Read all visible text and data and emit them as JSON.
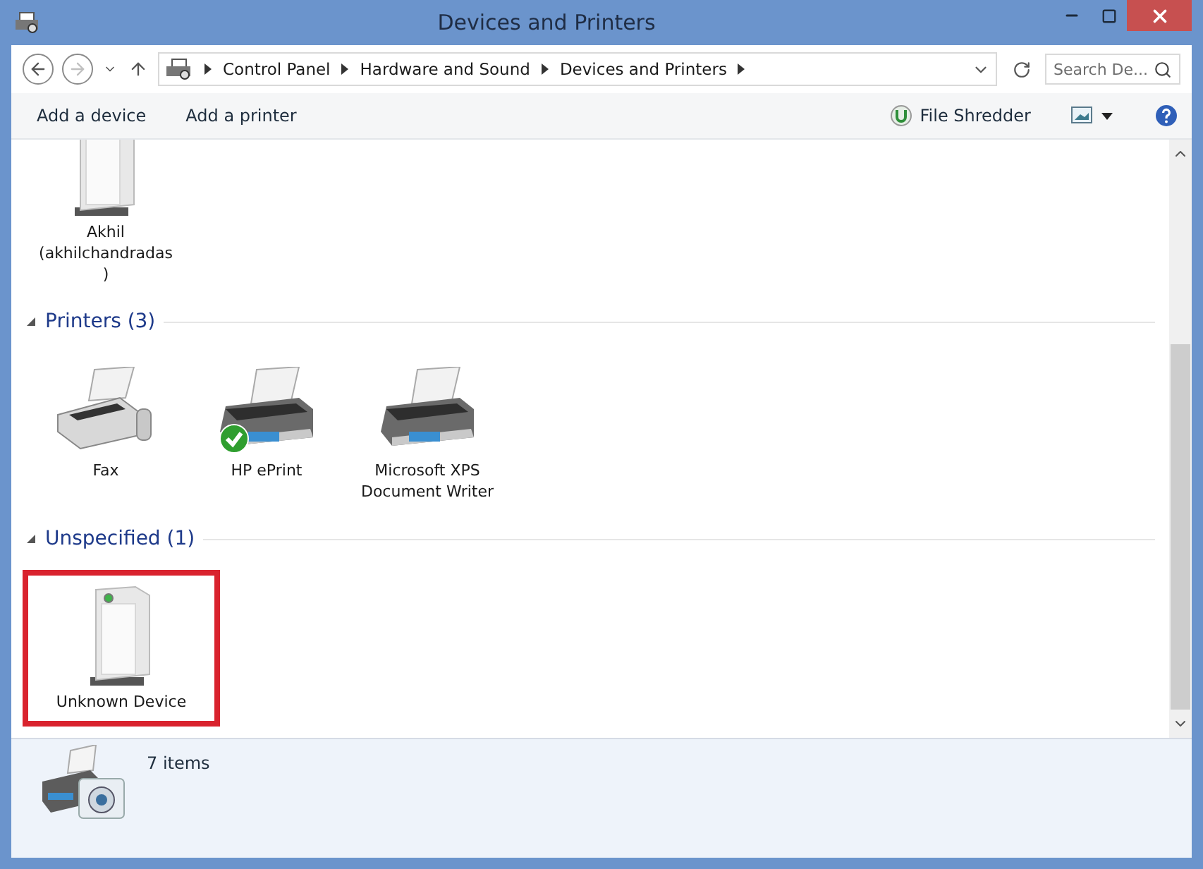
{
  "window": {
    "title": "Devices and Printers"
  },
  "address_bar": {
    "breadcrumbs": [
      "Control Panel",
      "Hardware and Sound",
      "Devices and Printers"
    ]
  },
  "search": {
    "placeholder": "Search De..."
  },
  "commands": [
    "Add a device",
    "Add a printer"
  ],
  "shredder": {
    "label": "File Shredder"
  },
  "top_items": [
    {
      "label": [
        "Akhil",
        "(akhilchandradas",
        ")"
      ],
      "kind": "tower",
      "default": false,
      "highlighted": false
    }
  ],
  "groups": [
    {
      "title": "Printers (3)",
      "expanded": true,
      "items": [
        {
          "label": [
            "Fax"
          ],
          "kind": "fax",
          "default": false,
          "highlighted": false
        },
        {
          "label": [
            "HP ePrint"
          ],
          "kind": "printer",
          "default": true,
          "highlighted": false
        },
        {
          "label": [
            "Microsoft XPS",
            "Document Writer"
          ],
          "kind": "printer",
          "default": false,
          "highlighted": false
        }
      ]
    },
    {
      "title": "Unspecified (1)",
      "expanded": true,
      "items": [
        {
          "label": [
            "Unknown Device"
          ],
          "kind": "tower",
          "default": false,
          "highlighted": true
        }
      ]
    }
  ],
  "status_bar": {
    "count": "7 items"
  }
}
